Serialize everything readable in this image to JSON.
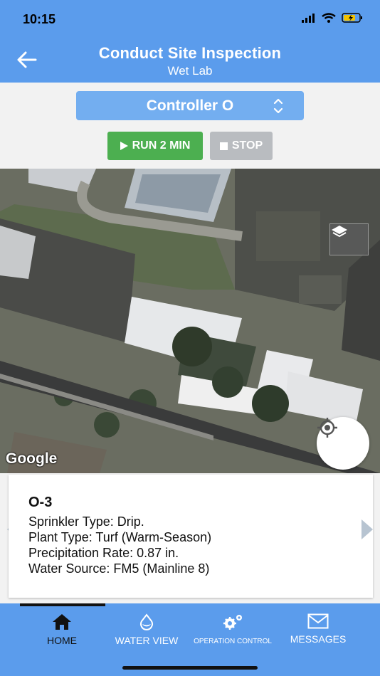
{
  "status_bar": {
    "time": "10:15"
  },
  "header": {
    "title": "Conduct Site Inspection",
    "subtitle": "Wet Lab"
  },
  "controller": {
    "selected": "Controller O"
  },
  "actions": {
    "run_label": "RUN 2 MIN",
    "stop_label": "STOP"
  },
  "map": {
    "attribution": "Google"
  },
  "zone": {
    "name": "O-3",
    "sprinkler_type": "Sprinkler Type: Drip.",
    "plant_type": "Plant Type: Turf (Warm-Season)",
    "precipitation_rate": "Precipitation Rate: 0.87 in.",
    "water_source": "Water Source: FM5 (Mainline 8)"
  },
  "nav": {
    "items": [
      {
        "label": "HOME",
        "icon": "home-icon"
      },
      {
        "label": "WATER VIEW",
        "icon": "water-drop-icon"
      },
      {
        "label": "OPERATION CONTROL",
        "icon": "gears-icon"
      },
      {
        "label": "MESSAGES",
        "icon": "envelope-icon"
      }
    ]
  },
  "colors": {
    "header": "#5b9cec",
    "run": "#4caf50",
    "stop": "#b9bcc0"
  }
}
